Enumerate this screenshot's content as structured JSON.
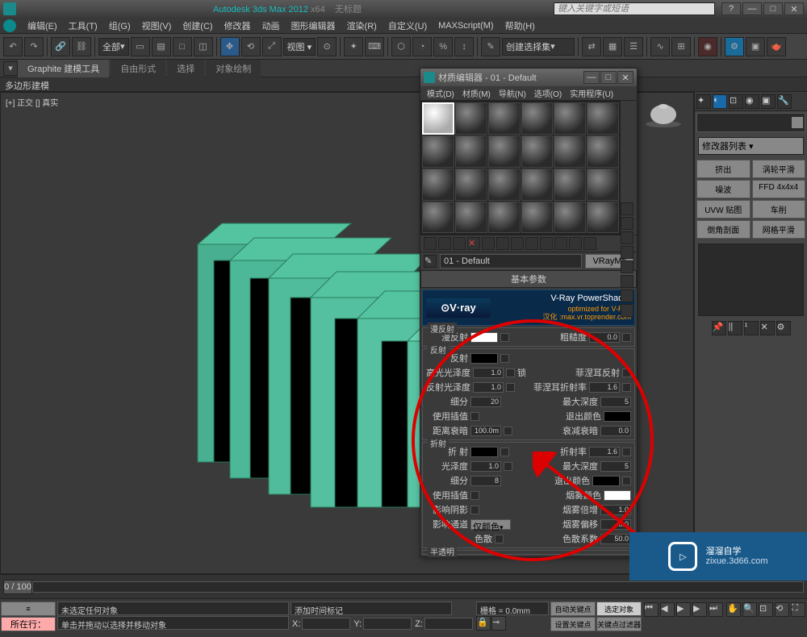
{
  "title": {
    "app": "Autodesk 3ds Max 2012",
    "arch": "x64",
    "file": "无标题"
  },
  "search_placeholder": "键入关键字或短语",
  "menus": [
    "编辑(E)",
    "工具(T)",
    "组(G)",
    "视图(V)",
    "创建(C)",
    "修改器",
    "动画",
    "图形编辑器",
    "渲染(R)",
    "自定义(U)",
    "MAXScript(M)",
    "帮助(H)"
  ],
  "toolbar_sel": "全部",
  "toolbar_selset": "创建选择集",
  "tabs": [
    "Graphite 建模工具",
    "自由形式",
    "选择",
    "对象绘制"
  ],
  "subheader": "多边形建模",
  "viewport_label": "[+] 正交 [] 真实",
  "right_panel": {
    "dropdown": "修改器列表",
    "buttons": [
      "挤出",
      "涡轮平滑",
      "噪波",
      "FFD 4x4x4",
      "UVW 贴图",
      "车削",
      "倒角剖面",
      "网格平滑"
    ]
  },
  "mat_editor": {
    "title": "材质编辑器 - 01 - Default",
    "menus": [
      "模式(D)",
      "材质(M)",
      "导航(N)",
      "选项(O)",
      "实用程序(U)"
    ],
    "name": "01 - Default",
    "type": "VRayMtl",
    "section": "基本参数",
    "vray": {
      "brand": "V-Ray PowerShader",
      "sub": "optimized for V-Ray",
      "url": "汉化 :max.vr.toprender.com"
    },
    "diffuse": {
      "group": "漫反射",
      "label": "漫反射",
      "rough_label": "粗糙度",
      "rough": "0.0"
    },
    "reflect": {
      "group": "反射",
      "label": "反射",
      "hilight_label": "高光光泽度",
      "hilight": "1.0",
      "lock_label": "锁",
      "fresnel_label": "菲涅耳反射",
      "refl_gloss_label": "反射光泽度",
      "refl_gloss": "1.0",
      "fresnel_ior_label": "菲涅耳折射率",
      "fresnel_ior": "1.6",
      "subdiv_label": "细分",
      "subdiv": "20",
      "maxdepth_label": "最大深度",
      "maxdepth": "5",
      "interp_label": "使用插值",
      "exit_label": "退出颜色",
      "dim_label": "距离衰暗",
      "dim": "100.0m",
      "dim_falloff_label": "衰减衰暗",
      "dim_falloff": "0.0"
    },
    "refract": {
      "group": "折射",
      "label": "折 射",
      "ior_label": "折射率",
      "ior": "1.6",
      "gloss_label": "光泽度",
      "gloss": "1.0",
      "maxdepth_label": "最大深度",
      "maxdepth": "5",
      "subdiv_label": "细分",
      "subdiv": "8",
      "exit_label": "退出颜色",
      "interp_label": "使用插值",
      "fog_label": "烟雾颜色",
      "shadow_label": "影响阴影",
      "fog_mult_label": "烟雾倍增",
      "fog_mult": "1.0",
      "channel_label": "影响通道",
      "channel": "仅颜色",
      "fog_bias_label": "烟雾偏移",
      "fog_bias": "0.0",
      "dispersion_label": "色散",
      "dispersion_abbe_label": "色散系数",
      "dispersion_abbe": "50.0"
    },
    "translucency_group": "半透明"
  },
  "timeline": {
    "range": "0 / 100"
  },
  "status": {
    "frame_btn": "所在行：",
    "msg1": "未选定任何对象",
    "msg2": "单击并拖动以选择并移动对象",
    "add_time": "添加时间标记",
    "grid": "栅格 = 0.0mm",
    "autokey": "自动关键点",
    "setkey": "设置关键点",
    "selobj": "选定对象",
    "keyfilter": "关键点过滤器"
  },
  "watermark": {
    "brand": "溜溜自学",
    "url": "zixue.3d66.com"
  },
  "coords": {
    "x": "X:",
    "y": "Y:",
    "z": "Z:"
  }
}
